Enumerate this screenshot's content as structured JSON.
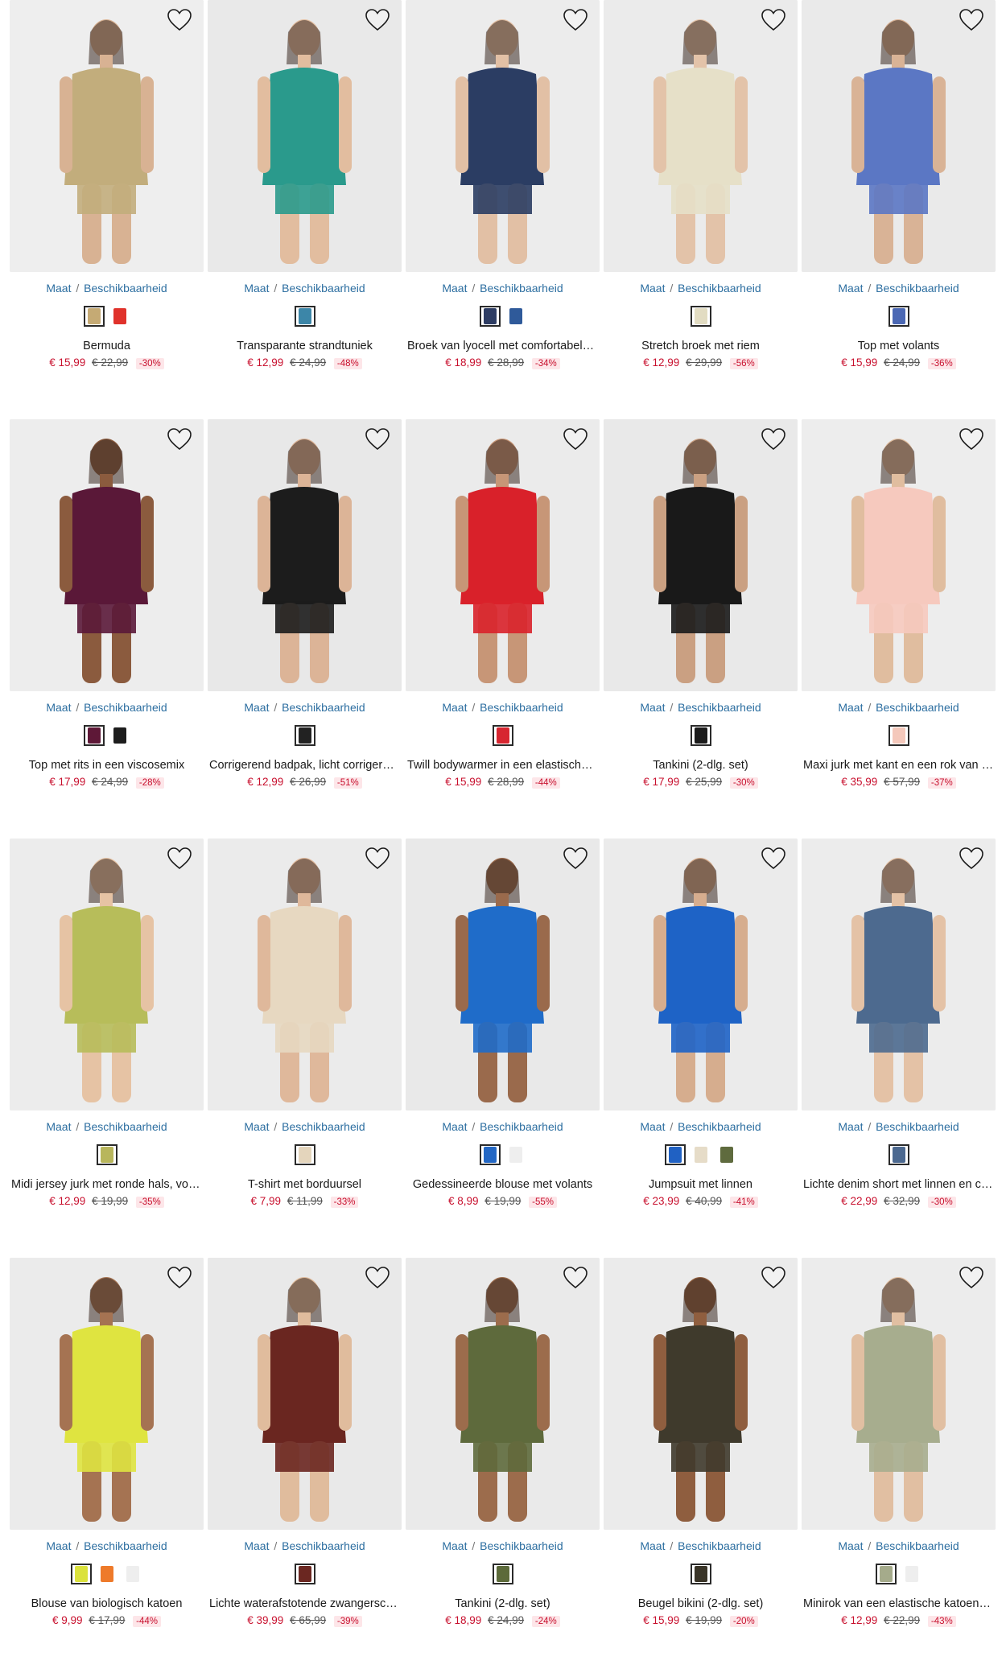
{
  "ui": {
    "avail_maat": "Maat",
    "avail_sep": "/",
    "avail_label": "Beschikbaarheid"
  },
  "products": [
    {
      "name": "Bermuda",
      "price": "€ 15,99",
      "old_price": "€ 22,99",
      "discount": "-30%",
      "bg": "#eeeeee",
      "tone": "#c2ad7c",
      "skin": "#d8b293",
      "swatches": [
        "#c5aa74",
        "#e0322b"
      ]
    },
    {
      "name": "Transparante strandtuniek",
      "price": "€ 12,99",
      "old_price": "€ 24,99",
      "discount": "-48%",
      "bg": "#e9e9e9",
      "tone": "#2a9a8c",
      "skin": "#e2bd9f",
      "swatches": [
        "#3c86a8"
      ]
    },
    {
      "name": "Broek van lyocell met comfortabele band",
      "price": "€ 18,99",
      "old_price": "€ 28,99",
      "discount": "-34%",
      "bg": "#ececec",
      "tone": "#2b3d63",
      "skin": "#e2c0a5",
      "swatches": [
        "#2d3c63",
        "#2f5a9a"
      ]
    },
    {
      "name": "Stretch broek met riem",
      "price": "€ 12,99",
      "old_price": "€ 29,99",
      "discount": "-56%",
      "bg": "#ebebeb",
      "tone": "#e6e0c8",
      "skin": "#e3c3a9",
      "swatches": [
        "#e2dcc2"
      ]
    },
    {
      "name": "Top met volants",
      "price": "€ 15,99",
      "old_price": "€ 24,99",
      "discount": "-36%",
      "bg": "#eaeaea",
      "tone": "#5b77c4",
      "skin": "#d9b396",
      "swatches": [
        "#4b68b4"
      ]
    },
    {
      "name": "Top met rits in een viscosemix",
      "price": "€ 17,99",
      "old_price": "€ 24,99",
      "discount": "-28%",
      "bg": "#ededed",
      "tone": "#5a1838",
      "skin": "#8b5b3e",
      "swatches": [
        "#5e1837",
        "#1d1d1d"
      ]
    },
    {
      "name": "Corrigerend badpak, licht corrigerend",
      "price": "€ 12,99",
      "old_price": "€ 26,99",
      "discount": "-51%",
      "bg": "#e8e8e8",
      "tone": "#1c1c1c",
      "skin": "#dcb497",
      "swatches": [
        "#222222"
      ]
    },
    {
      "name": "Twill bodywarmer in een elastische katoenmix",
      "price": "€ 15,99",
      "old_price": "€ 28,99",
      "discount": "-44%",
      "bg": "#ebebeb",
      "tone": "#d9212a",
      "skin": "#c79677",
      "swatches": [
        "#d72630"
      ]
    },
    {
      "name": "Tankini (2-dlg. set)",
      "price": "€ 17,99",
      "old_price": "€ 25,99",
      "discount": "-30%",
      "bg": "#e9e9e9",
      "tone": "#191919",
      "skin": "#caa082",
      "swatches": [
        "#1c1c1c"
      ]
    },
    {
      "name": "Maxi jurk met kant en een rok van tule",
      "price": "€ 35,99",
      "old_price": "€ 57,99",
      "discount": "-37%",
      "bg": "#ededed",
      "tone": "#f6c9be",
      "skin": "#e0bd9f",
      "swatches": [
        "#f4c8bb"
      ]
    },
    {
      "name": "Midi jersey jurk met ronde hals, volants en knopen",
      "price": "€ 12,99",
      "old_price": "€ 19,99",
      "discount": "-35%",
      "bg": "#ececec",
      "tone": "#b7bd5a",
      "skin": "#e6c3a4",
      "swatches": [
        "#b8b65c"
      ]
    },
    {
      "name": "T-shirt met borduursel",
      "price": "€ 7,99",
      "old_price": "€ 11,99",
      "discount": "-33%",
      "bg": "#ebebeb",
      "tone": "#e7d8c1",
      "skin": "#dfb89b",
      "swatches": [
        "#e4d5bc"
      ]
    },
    {
      "name": "Gedessineerde blouse met volants",
      "price": "€ 8,99",
      "old_price": "€ 19,99",
      "discount": "-55%",
      "bg": "#e9e9e9",
      "tone": "#1f6cc9",
      "skin": "#9a6a4c",
      "swatches": [
        "#2367c4",
        "#eeeeee"
      ]
    },
    {
      "name": "Jumpsuit met linnen",
      "price": "€ 23,99",
      "old_price": "€ 40,99",
      "discount": "-41%",
      "bg": "#ebebeb",
      "tone": "#1e63c6",
      "skin": "#d6ad8e",
      "swatches": [
        "#2061c3",
        "#e6dcc8",
        "#5f6b3e"
      ]
    },
    {
      "name": "Lichte denim short met linnen en comfortband",
      "price": "€ 22,99",
      "old_price": "€ 32,99",
      "discount": "-30%",
      "bg": "#ececec",
      "tone": "#4d6a8f",
      "skin": "#e4c2a6",
      "swatches": [
        "#4c6990"
      ]
    },
    {
      "name": "Blouse van biologisch katoen",
      "price": "€ 9,99",
      "old_price": "€ 17,99",
      "discount": "-44%",
      "bg": "#ebebeb",
      "tone": "#dfe440",
      "skin": "#a57352",
      "swatches": [
        "#dbe23c",
        "#ee7a2a",
        "#eeeeee"
      ]
    },
    {
      "name": "Lichte waterafstotende zwangerschapsjas",
      "price": "€ 39,99",
      "old_price": "€ 65,99",
      "discount": "-39%",
      "bg": "#e9e9e9",
      "tone": "#6a2620",
      "skin": "#e0bc9d",
      "swatches": [
        "#6b2721"
      ]
    },
    {
      "name": "Tankini (2-dlg. set)",
      "price": "€ 18,99",
      "old_price": "€ 24,99",
      "discount": "-24%",
      "bg": "#eaeaea",
      "tone": "#5e6a3c",
      "skin": "#9c6c4c",
      "swatches": [
        "#5c6a3a"
      ]
    },
    {
      "name": "Beugel bikini (2-dlg. set)",
      "price": "€ 15,99",
      "old_price": "€ 19,99",
      "discount": "-20%",
      "bg": "#ebebeb",
      "tone": "#3f3a2c",
      "skin": "#8f5e3f",
      "swatches": [
        "#3a3528"
      ]
    },
    {
      "name": "Minirok van een elastische katoenmix",
      "price": "€ 12,99",
      "old_price": "€ 22,99",
      "discount": "-43%",
      "bg": "#ececec",
      "tone": "#a7ad8e",
      "skin": "#e1bfa2",
      "swatches": [
        "#a5ab8b",
        "#eeeeee"
      ]
    }
  ]
}
